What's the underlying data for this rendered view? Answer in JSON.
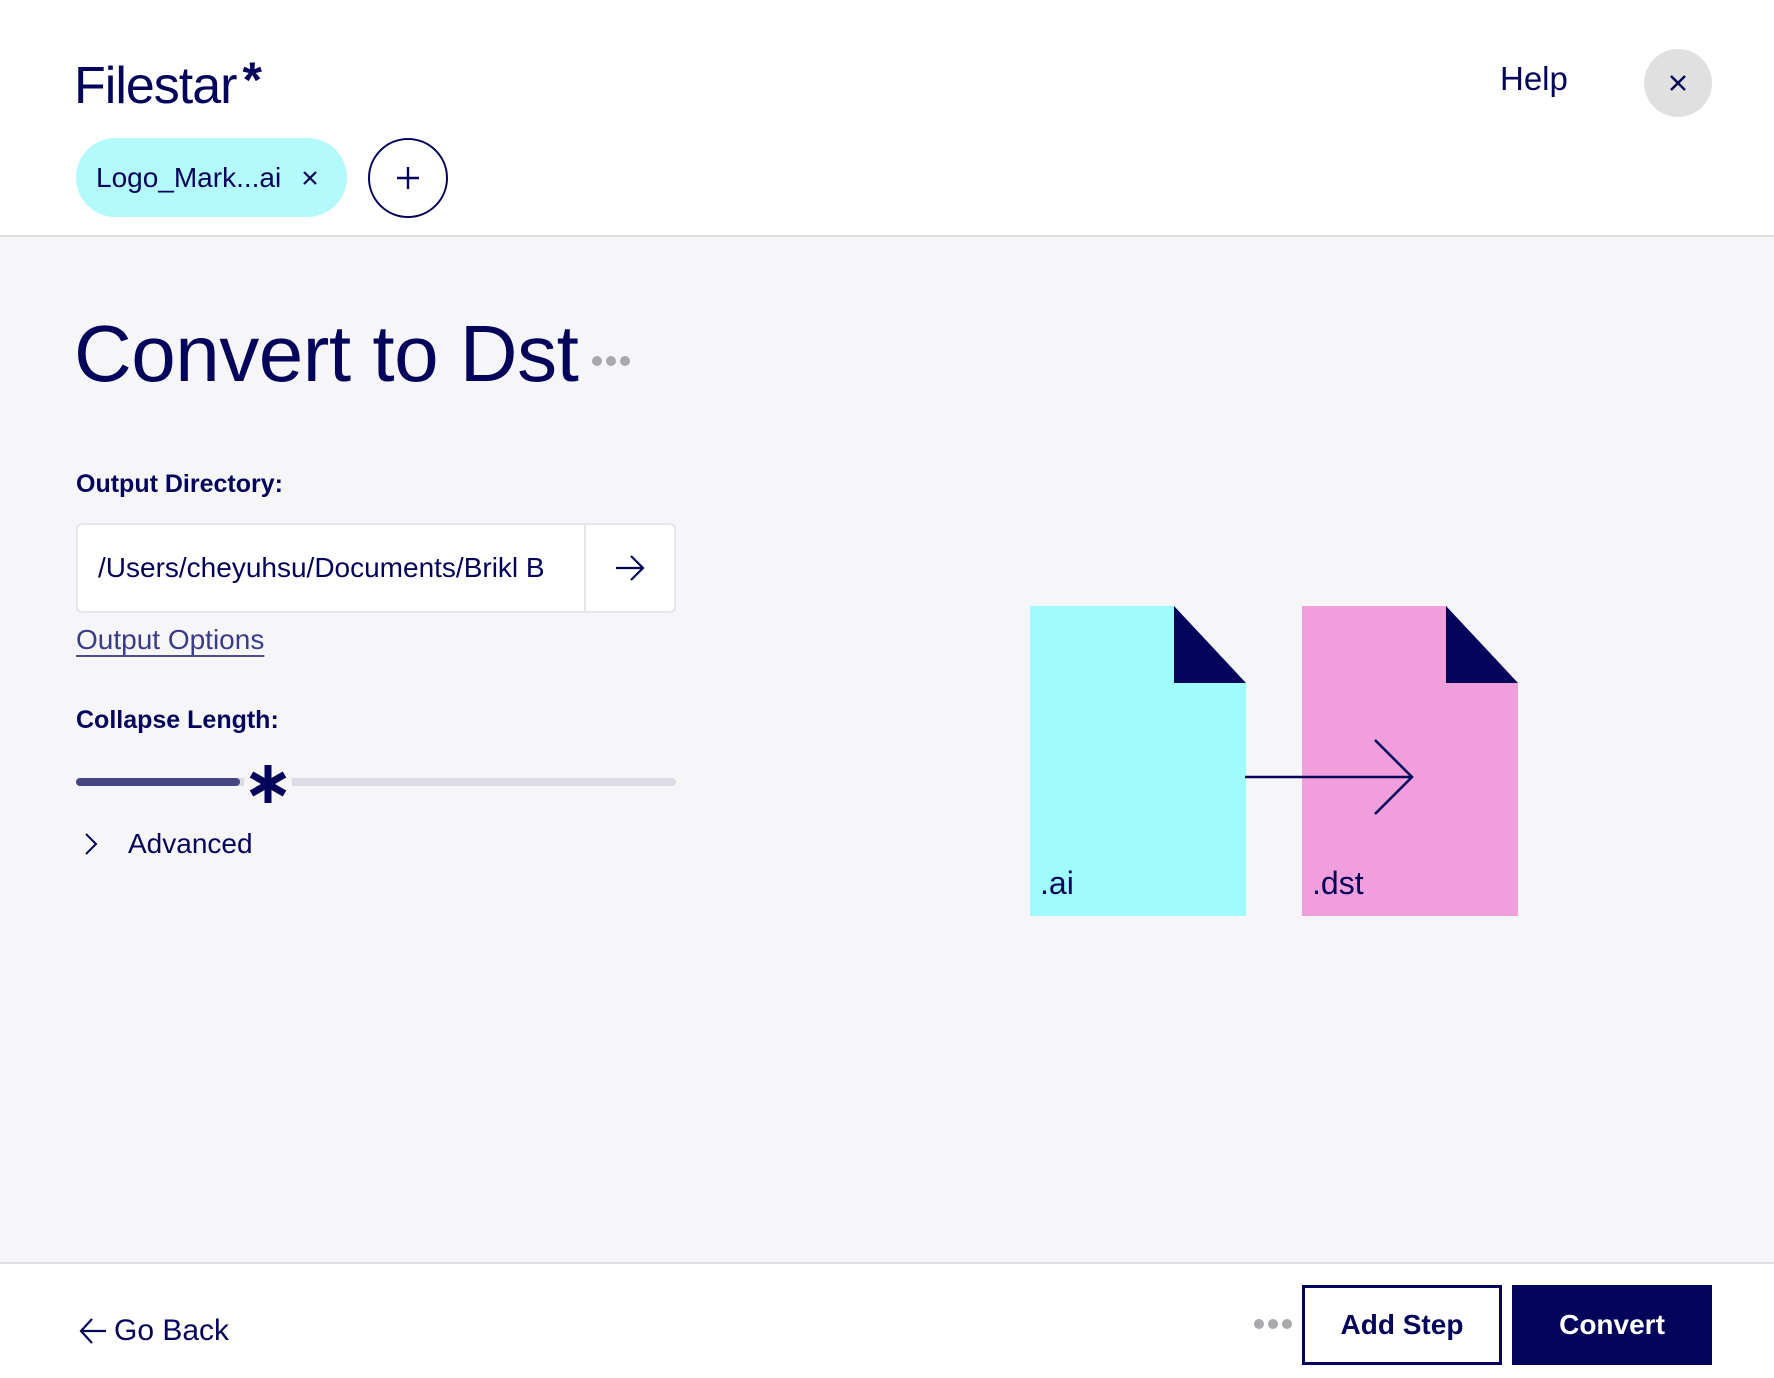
{
  "header": {
    "logo_text": "Filestar",
    "logo_mark": "*",
    "help_label": "Help",
    "close_icon": "close-icon",
    "files": [
      {
        "name": "Logo_Mark...ai",
        "remove_icon": "close-icon"
      }
    ],
    "add_file_icon": "plus-icon"
  },
  "main": {
    "title": "Convert to Dst",
    "title_menu_icon": "more-dots-icon",
    "output_directory": {
      "label": "Output Directory:",
      "value": "/Users/cheyuhsu/Documents/Brikl B",
      "go_icon": "arrow-right-icon"
    },
    "output_options_link": "Output Options",
    "collapse_length": {
      "label": "Collapse Length:",
      "value_fraction": 0.32,
      "thumb_icon": "asterisk-icon"
    },
    "advanced": {
      "label": "Advanced",
      "expanded": false,
      "icon": "chevron-right-icon"
    },
    "illustration": {
      "source_ext": ".ai",
      "target_ext": ".dst",
      "source_color": "#a0fcfc",
      "target_color": "#f09fdc",
      "corner_color": "#03045a"
    }
  },
  "footer": {
    "go_back_label": "Go Back",
    "more_icon": "more-dots-icon",
    "add_step_label": "Add Step",
    "convert_label": "Convert"
  },
  "colors": {
    "primary": "#03045a",
    "chip_bg": "#b4f9fc",
    "page_bg": "#f6f6f9"
  }
}
